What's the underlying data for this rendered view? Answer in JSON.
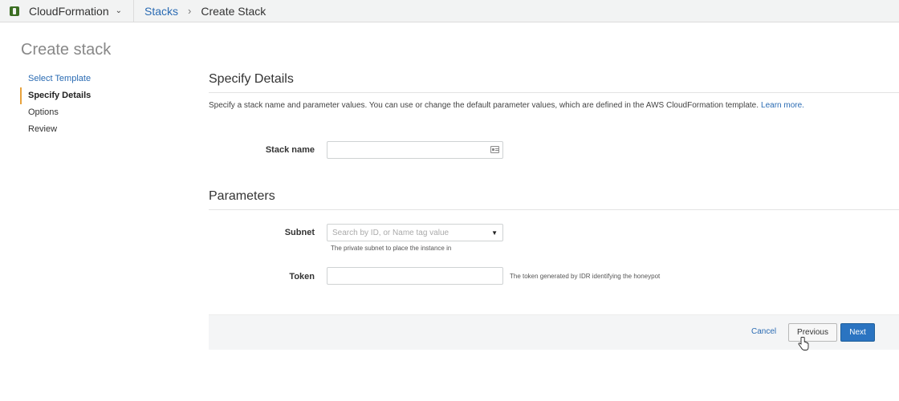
{
  "header": {
    "service_name": "CloudFormation",
    "breadcrumbs": [
      "Stacks",
      "Create Stack"
    ],
    "breadcrumb_separator": "›"
  },
  "page": {
    "title": "Create stack"
  },
  "wizard": {
    "steps": [
      {
        "label": "Select Template",
        "state": "link"
      },
      {
        "label": "Specify Details",
        "state": "active"
      },
      {
        "label": "Options",
        "state": "plain"
      },
      {
        "label": "Review",
        "state": "plain"
      }
    ]
  },
  "details": {
    "title": "Specify Details",
    "description": "Specify a stack name and parameter values. You can use or change the default parameter values, which are defined in the AWS CloudFormation template.",
    "learn_more": "Learn more.",
    "stack_name": {
      "label": "Stack name",
      "value": "",
      "placeholder": ""
    }
  },
  "parameters": {
    "title": "Parameters",
    "subnet": {
      "label": "Subnet",
      "placeholder": "Search by ID, or Name tag value",
      "hint": "The private subnet to place the instance in"
    },
    "token": {
      "label": "Token",
      "value": "",
      "hint": "The token generated by IDR identifying the honeypot"
    }
  },
  "footer": {
    "cancel_label": "Cancel",
    "previous_label": "Previous",
    "next_label": "Next"
  },
  "colors": {
    "link": "#2a6bb3",
    "primary_button": "#2b74c1",
    "active_step_marker": "#e8a23c",
    "service_logo": "#3b6e22"
  },
  "icons": {
    "service": "cloudformation-logo-icon",
    "service_menu": "chevron-down-icon",
    "stack_name_field": "id-card-icon",
    "subnet_select": "caret-down-icon"
  }
}
